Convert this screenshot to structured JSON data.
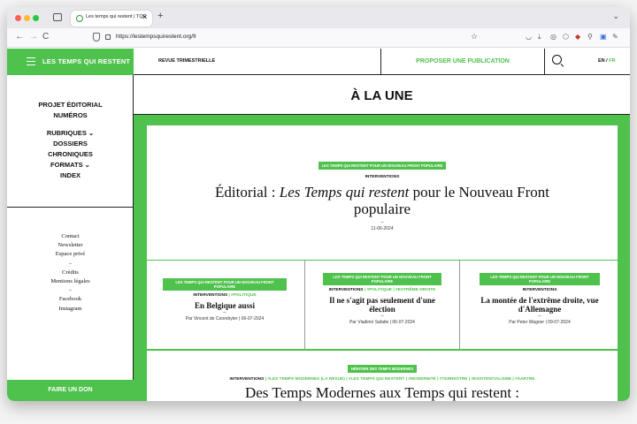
{
  "browser": {
    "tab_title": "Les temps qui restent | TQR",
    "tab_close": "✕",
    "new_tab": "+",
    "tabs_menu": "⌄",
    "back": "←",
    "forward": "→",
    "reload": "C",
    "url": "https://lestempsquirestent.org/fr",
    "star": "☆",
    "toolbar_icons": [
      "pocket-icon",
      "download-icon",
      "account-icon",
      "extensions-icon",
      "shield-extension-icon",
      "key-icon",
      "sidebar-icon",
      "pen-icon"
    ],
    "toolbar_glyphs": [
      "◡",
      "⤓",
      "◎",
      "⬡",
      "◆",
      "⚲",
      "▣",
      "✎"
    ]
  },
  "sidebar": {
    "brand": "LES TEMPS QUI RESTENT",
    "nav": [
      "PROJET ÉDITORIAL",
      "NUMÉROS",
      "",
      "RUBRIQUES ⌄",
      "DOSSIERS",
      "CHRONIQUES",
      "FORMATS ⌄",
      "INDEX"
    ],
    "links": [
      "Contact",
      "Newsletter",
      "Espace privé",
      "–",
      "Crédits",
      "Mentions légales",
      "–",
      "Facebook",
      "Instagram"
    ],
    "donate": "FAIRE UN DON"
  },
  "topbar": {
    "revue": "REVUE TRIMESTRIELLE",
    "propose": "PROPOSER UNE PUBLICATION",
    "lang_en": "EN",
    "lang_sep": " / ",
    "lang_fr": "FR"
  },
  "une": {
    "title": "À LA UNE"
  },
  "main_article": {
    "tag": "LES TEMPS QUI RESTENT POUR UN NOUVEAU FRONT POPULAIRE",
    "rubric": "INTERVENTIONS",
    "title_pre": "Éditorial : ",
    "title_em": "Les Temps qui restent",
    "title_post": " pour le Nouveau Front populaire",
    "dash": "–",
    "date": "11-06-2024"
  },
  "articles": [
    {
      "tag": "LES TEMPS QUI RESTENT POUR UN NOUVEAU FRONT POPULAIRE",
      "rubric": "INTERVENTIONS",
      "extra": " | #POLITIQUE",
      "title": "En Belgique aussi",
      "dash": "–",
      "meta": "Par Vincent de Coorebyter | 06-07-2024"
    },
    {
      "tag": "LES TEMPS QUI RESTENT POUR UN NOUVEAU FRONT POPULAIRE",
      "rubric": "INTERVENTIONS",
      "extra": " | #POLITIQUE | #EXTRÊME DROITE",
      "title": "Il ne s'agit pas seulement d'une élection",
      "dash": "–",
      "meta": "Par Vladimir Safatle | 06-07-2024"
    },
    {
      "tag": "LES TEMPS QUI RESTENT POUR UN NOUVEAU FRONT POPULAIRE",
      "rubric": "INTERVENTIONS",
      "extra": "",
      "title": "La montée de l'extrême droite, vue d'Allemagne",
      "dash": "–",
      "meta": "Par Peter Wagner | 09-07-2024"
    }
  ],
  "bottom_article": {
    "tag": "HÉRITIER DES TEMPS MODERNES",
    "rubric": "INTERVENTIONS",
    "extra": " | #LES TEMPS MODERNES (LA REVUE) | #LES TEMPS QUI RESTENT | #MODERNITÉ | #TERRESTRE | #EXISTENTIALISME | #SARTRE",
    "title": "Des Temps Modernes aux Temps qui restent :"
  },
  "colors": {
    "brand_green": "#4fc14d",
    "text": "#111111"
  }
}
